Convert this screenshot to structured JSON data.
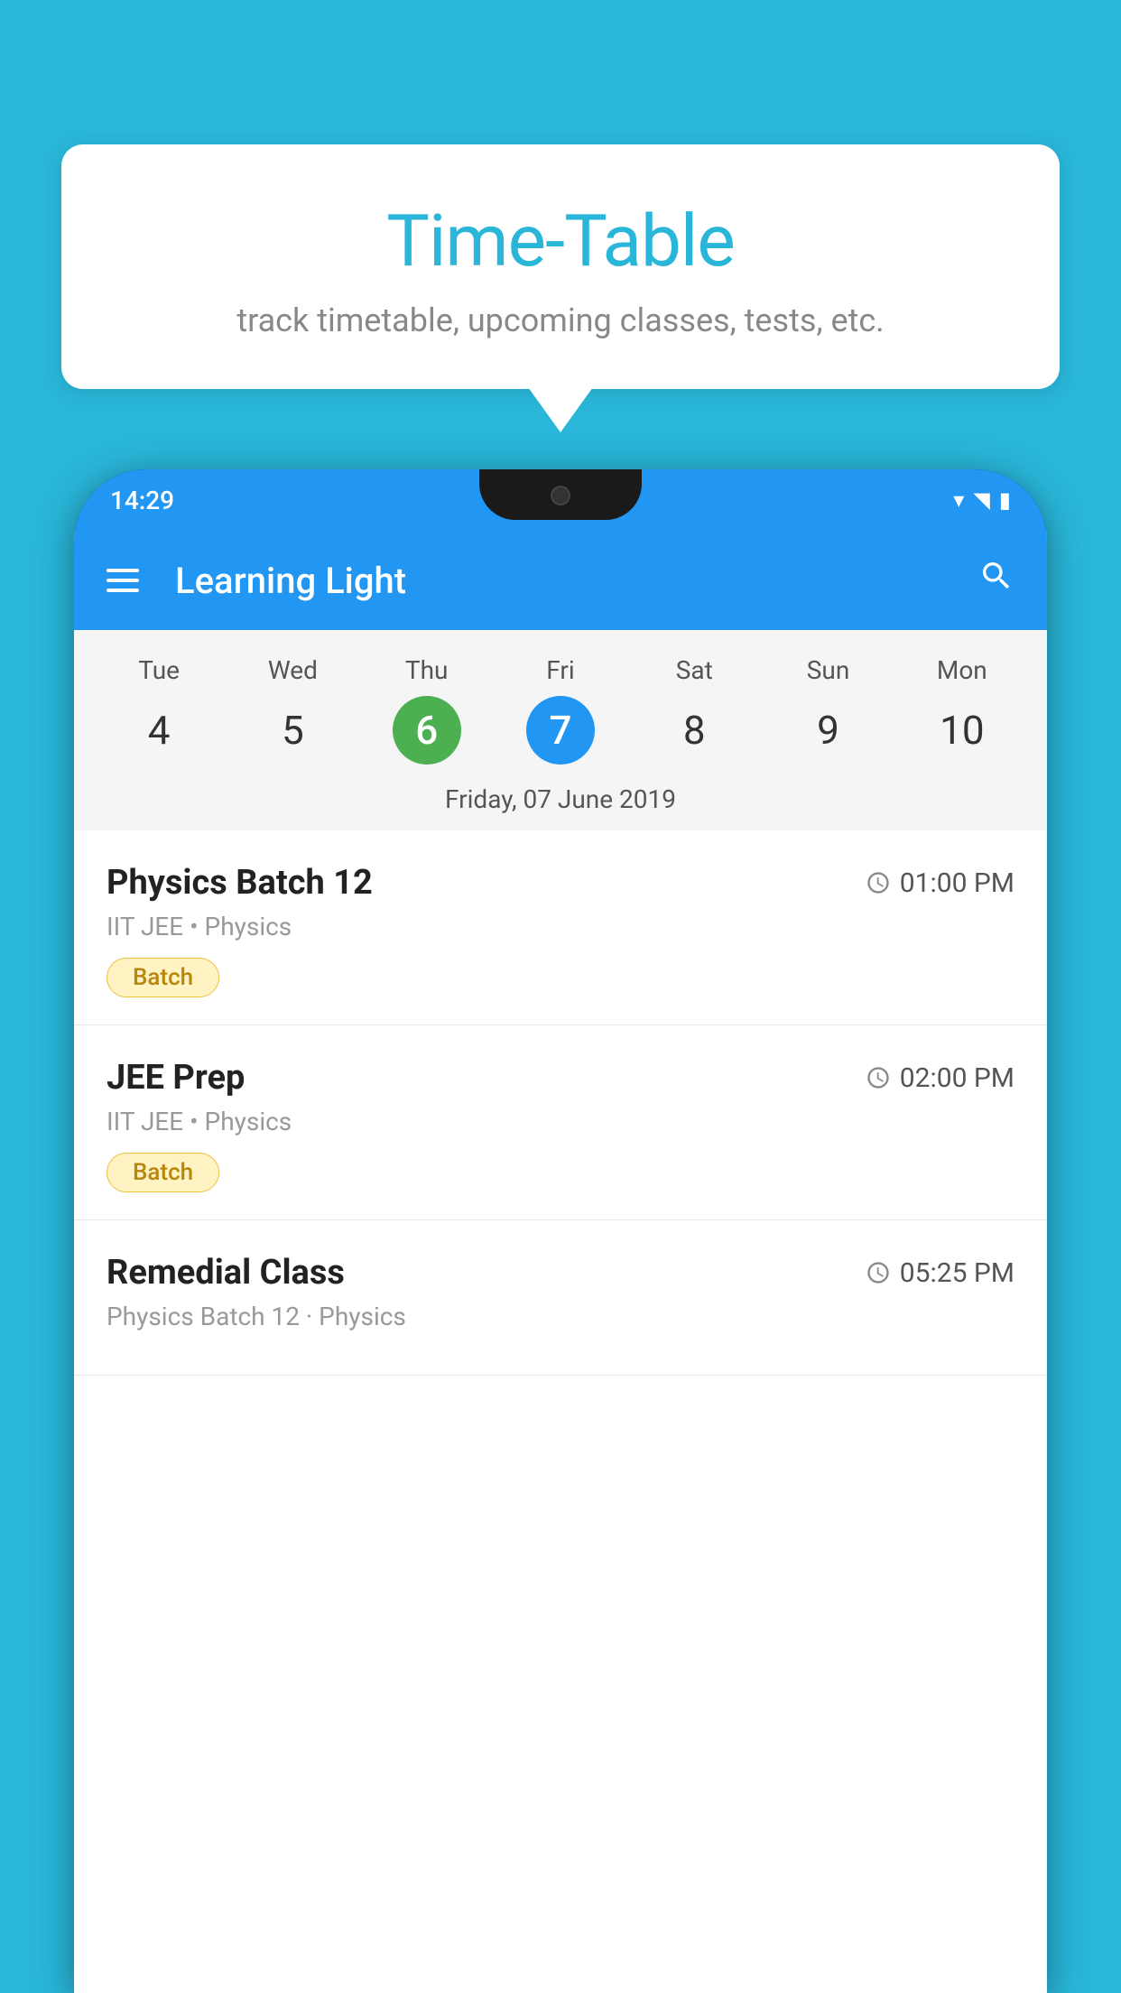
{
  "background_color": "#29B6D9",
  "bubble": {
    "title": "Time-Table",
    "subtitle": "track timetable, upcoming classes, tests, etc."
  },
  "phone": {
    "status_bar": {
      "time": "14:29"
    },
    "app_bar": {
      "title": "Learning Light"
    },
    "calendar": {
      "days": [
        {
          "label": "Tue",
          "num": "4",
          "state": "normal"
        },
        {
          "label": "Wed",
          "num": "5",
          "state": "normal"
        },
        {
          "label": "Thu",
          "num": "6",
          "state": "today"
        },
        {
          "label": "Fri",
          "num": "7",
          "state": "selected"
        },
        {
          "label": "Sat",
          "num": "8",
          "state": "normal"
        },
        {
          "label": "Sun",
          "num": "9",
          "state": "normal"
        },
        {
          "label": "Mon",
          "num": "10",
          "state": "normal"
        }
      ],
      "selected_date_label": "Friday, 07 June 2019"
    },
    "schedule": [
      {
        "title": "Physics Batch 12",
        "time": "01:00 PM",
        "meta": "IIT JEE • Physics",
        "badge": "Batch"
      },
      {
        "title": "JEE Prep",
        "time": "02:00 PM",
        "meta": "IIT JEE • Physics",
        "badge": "Batch"
      },
      {
        "title": "Remedial Class",
        "time": "05:25 PM",
        "meta": "Physics Batch 12 · Physics",
        "badge": null
      }
    ]
  }
}
